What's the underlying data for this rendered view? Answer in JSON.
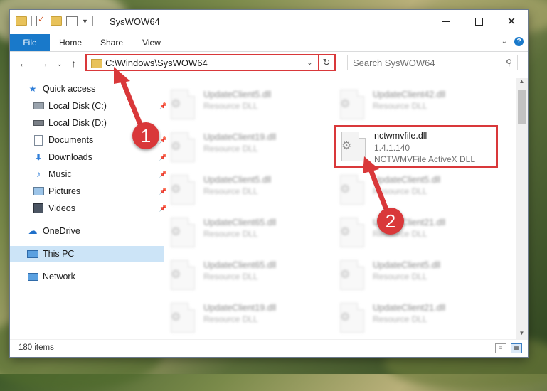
{
  "window": {
    "title": "SysWOW64"
  },
  "ribbon": {
    "tabs": [
      "File",
      "Home",
      "Share",
      "View"
    ]
  },
  "navigation": {
    "address": "C:\\Windows\\SysWOW64",
    "search_placeholder": "Search SysWOW64"
  },
  "sidebar": {
    "items": [
      {
        "label": "Quick access",
        "icon": "star-icon"
      },
      {
        "label": "Local Disk (C:)",
        "icon": "drive-icon",
        "pinned": true
      },
      {
        "label": "Local Disk (D:)",
        "icon": "drive-icon"
      },
      {
        "label": "Documents",
        "icon": "documents-icon",
        "pinned": true
      },
      {
        "label": "Downloads",
        "icon": "downloads-icon",
        "pinned": true
      },
      {
        "label": "Music",
        "icon": "music-icon",
        "pinned": true
      },
      {
        "label": "Pictures",
        "icon": "pictures-icon",
        "pinned": true
      },
      {
        "label": "Videos",
        "icon": "videos-icon",
        "pinned": true
      },
      {
        "label": "OneDrive",
        "icon": "cloud-icon"
      },
      {
        "label": "This PC",
        "icon": "computer-icon",
        "selected": true
      },
      {
        "label": "Network",
        "icon": "network-icon"
      }
    ]
  },
  "files": {
    "left_column": [
      {
        "name": "UpdateClient5.dll",
        "type": "Resource DLL"
      },
      {
        "name": "UpdateClient19.dll",
        "type": "Resource DLL"
      },
      {
        "name": "UpdateClient5.dll",
        "type": "Resource DLL"
      },
      {
        "name": "UpdateClient65.dll",
        "type": "Resource DLL"
      },
      {
        "name": "UpdateClient65.dll",
        "type": "Resource DLL"
      },
      {
        "name": "UpdateClient19.dll",
        "type": "Resource DLL"
      }
    ],
    "right_column": [
      {
        "name": "UpdateClient42.dll",
        "type": "Resource DLL"
      },
      {
        "name": "UpdateClient5.dll",
        "type": "Resource DLL"
      },
      {
        "name": "UpdateClient21.dll",
        "type": "Resource DLL"
      },
      {
        "name": "UpdateClient5.dll",
        "type": "Resource DLL"
      },
      {
        "name": "UpdateClient21.dll",
        "type": "Resource DLL"
      }
    ],
    "highlighted": {
      "name": "nctwmvfile.dll",
      "version": "1.4.1.140",
      "description": "NCTWMVFile ActiveX DLL"
    }
  },
  "status": {
    "item_count": "180 items"
  },
  "annotations": {
    "step1": "1",
    "step2": "2",
    "color": "#d9383a"
  }
}
